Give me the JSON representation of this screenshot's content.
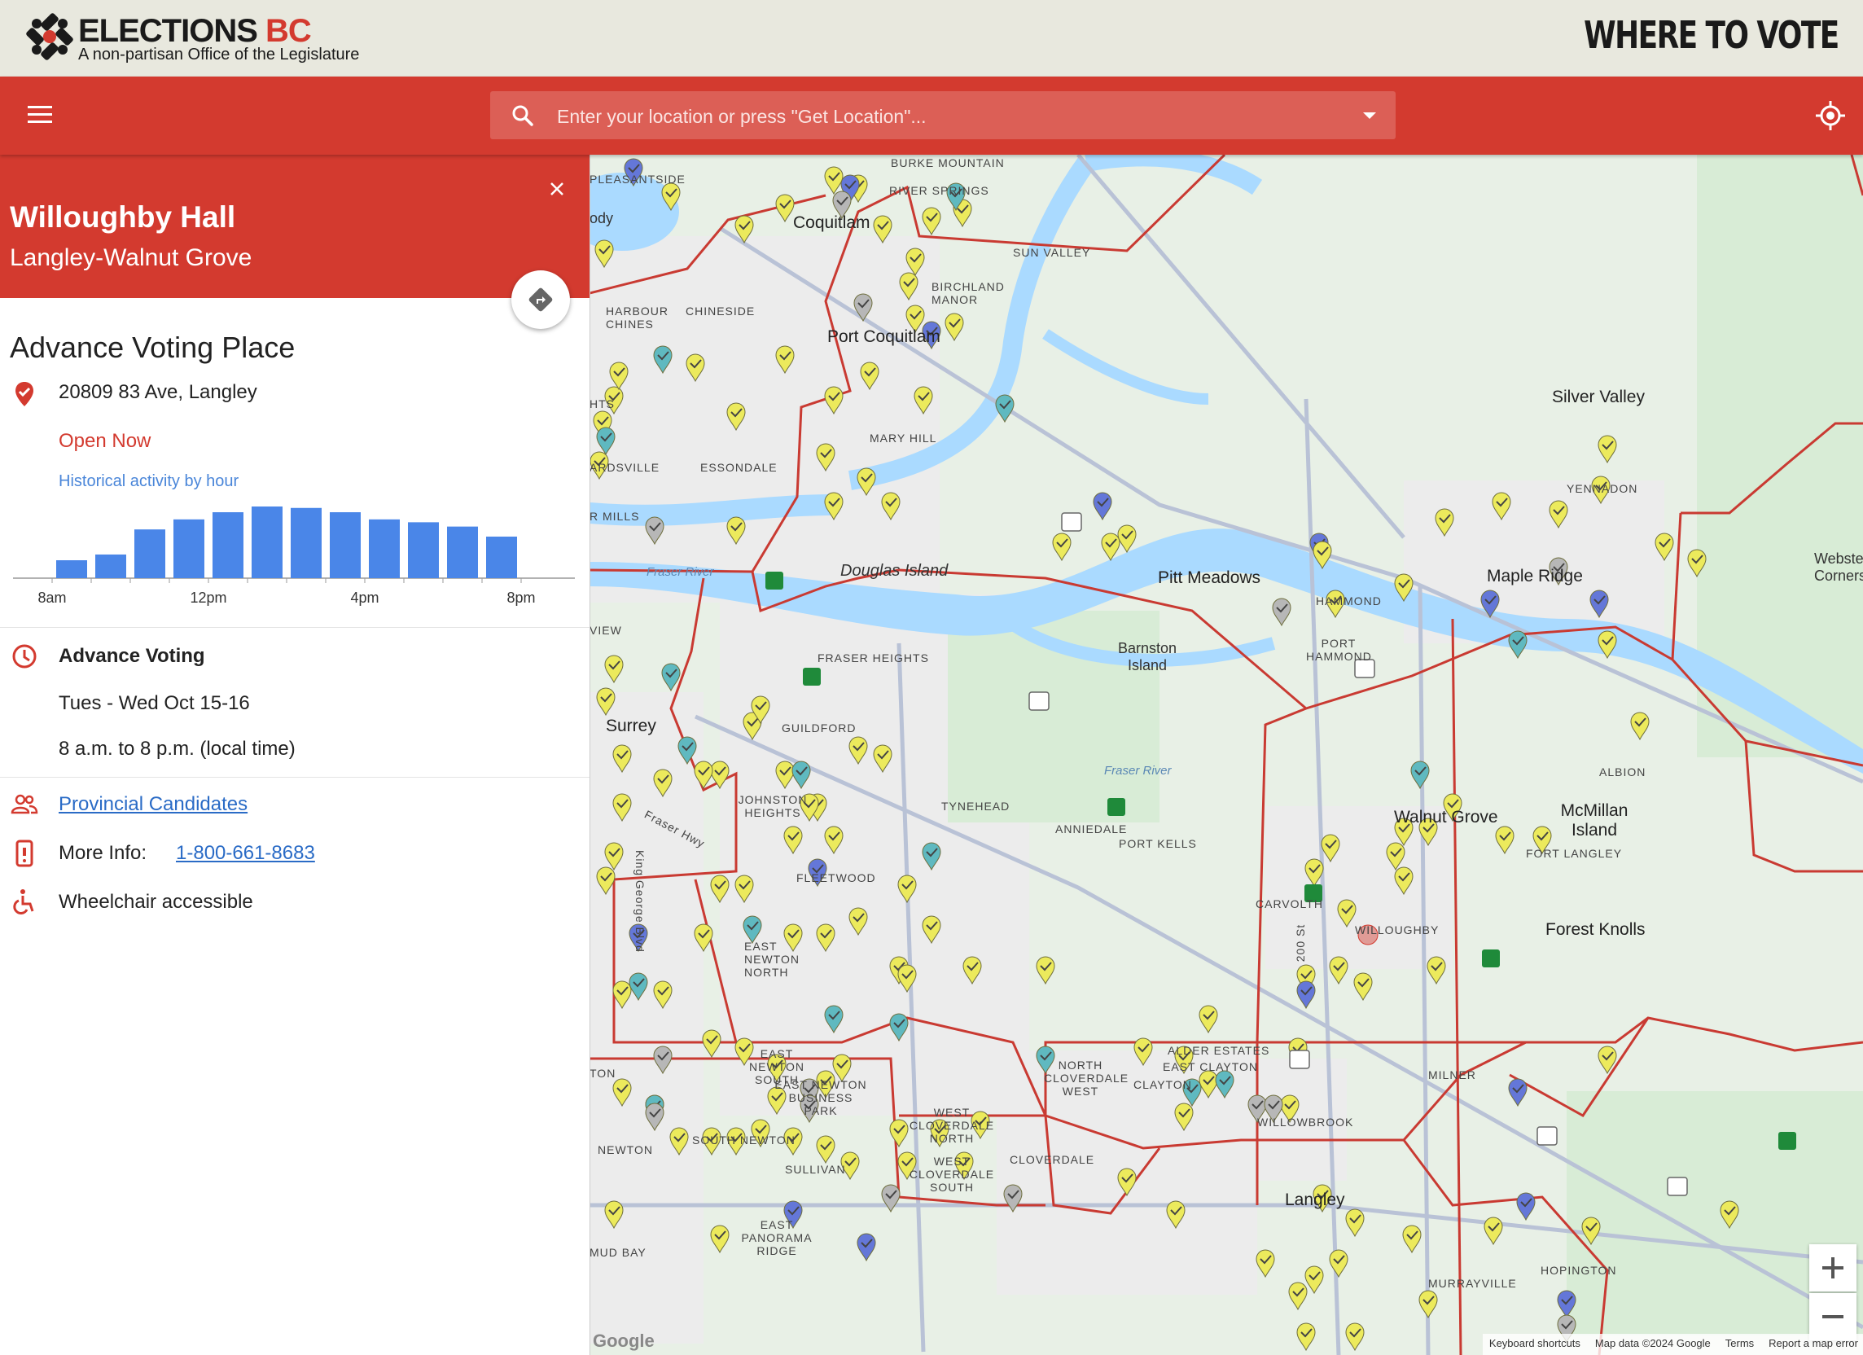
{
  "brand": {
    "name_main": "ELECTIONS",
    "name_accent": "BC",
    "tagline": "A non-partisan Office of the Legislature",
    "page_title": "WHERE TO VOTE"
  },
  "toolbar": {
    "search_placeholder": "Enter your location or press \"Get Location\"..."
  },
  "panel": {
    "place_name": "Willoughby Hall",
    "district": "Langley-Walnut Grove",
    "section_title": "Advance Voting Place",
    "address": "20809 83 Ave, Langley",
    "status": "Open Now",
    "activity_label": "Historical activity by hour",
    "voting_label": "Advance Voting",
    "voting_dates": "Tues - Wed Oct 15-16",
    "voting_hours": "8 a.m. to 8 p.m. (local time)",
    "candidates_link": "Provincial Candidates",
    "more_info_label": "More Info:",
    "more_info_phone": "1-800-661-8683",
    "accessibility": "Wheelchair accessible"
  },
  "chart_data": {
    "type": "bar",
    "title": "",
    "xlabel": "",
    "ylabel": "",
    "tick_labels": [
      "8am",
      "12pm",
      "4pm",
      "8pm"
    ],
    "values": [
      0.25,
      0.33,
      0.68,
      0.82,
      0.92,
      1.0,
      0.98,
      0.92,
      0.82,
      0.78,
      0.72,
      0.58
    ],
    "color": "#4a86e8"
  },
  "map": {
    "labels": {
      "burke_mountain": "BURKE MOUNTAIN",
      "pleasant_side": "PLEASANTSIDE",
      "river_springs": "RIVER SPRINGS",
      "coquitlam": "Coquitlam",
      "sun_valley": "SUN VALLEY",
      "birchland_manor": "BIRCHLAND MANOR",
      "harbour_chines": "HARBOUR CHINES",
      "chineside": "CHINESIDE",
      "port_coquitlam": "Port Coquitlam",
      "mary_hill": "MARY HILL",
      "essondale": "ESSONDALE",
      "silver_valley": "Silver Valley",
      "yennadon": "YENNADON",
      "douglas_island": "Douglas Island",
      "pitt_meadows": "Pitt Meadows",
      "maple_ridge": "Maple Ridge",
      "hammond": "HAMMOND",
      "port_hammond": "PORT HAMMOND",
      "webster_corners": "Webster's Corners",
      "barnston_island": "Barnston Island",
      "fraser_heights": "FRASER HEIGHTS",
      "guildford": "GUILDFORD",
      "surrey": "Surrey",
      "johnston_heights": "JOHNSTON HEIGHTS",
      "tynehead": "TYNEHEAD",
      "anniedale": "ANNIEDALE",
      "port_kells": "PORT KELLS",
      "walnut_grove": "Walnut Grove",
      "mcmillan_island": "McMillan Island",
      "fort_langley": "FORT LANGLEY",
      "albion": "ALBION",
      "fleetwood": "FLEETWOOD",
      "carvolth": "CARVOLTH",
      "willoughby": "WILLOUGHBY",
      "forest_knolls": "Forest Knolls",
      "east_newton_north": "EAST NEWTON NORTH",
      "east_newton_south": "EAST NEWTON SOUTH",
      "east_newton_business_park": "EAST NEWTON BUSINESS PARK",
      "north_cloverdale_west": "NORTH CLOVERDALE WEST",
      "aldergrove_estates": "ALDER ESTATES",
      "east_clayton": "EAST CLAYTON",
      "clayton": "CLAYTON",
      "milner": "MILNER",
      "willowbrook": "WILLOWBROOK",
      "west_cloverdale_north": "WEST CLOVERDALE NORTH",
      "west_cloverdale_south": "WEST CLOVERDALE SOUTH",
      "cloverdale": "CLOVERDALE",
      "newton": "NEWTON",
      "south_newton": "SOUTH NEWTON",
      "sullivan": "SULLIVAN",
      "east_panorama_ridge": "EAST PANORAMA RIDGE",
      "mud_bay": "MUD BAY",
      "langley": "Langley",
      "murrayville": "MURRAYVILLE",
      "hopington": "HOPINGTON",
      "fraser_river": "Fraser River",
      "fraser_hwy": "Fraser Hwy",
      "king_george_blvd": "King George Blvd",
      "st_200": "200 St",
      "ardsville": "ARDSVILLE",
      "hts": "HTS",
      "r_mills": "R MILLS",
      "dy": "ody",
      "view": "VIEW",
      "ton": "TON"
    },
    "attribution": {
      "google": "Google",
      "shortcuts": "Keyboard shortcuts",
      "map_data": "Map data ©2024 Google",
      "terms": "Terms",
      "report": "Report a map error"
    }
  }
}
